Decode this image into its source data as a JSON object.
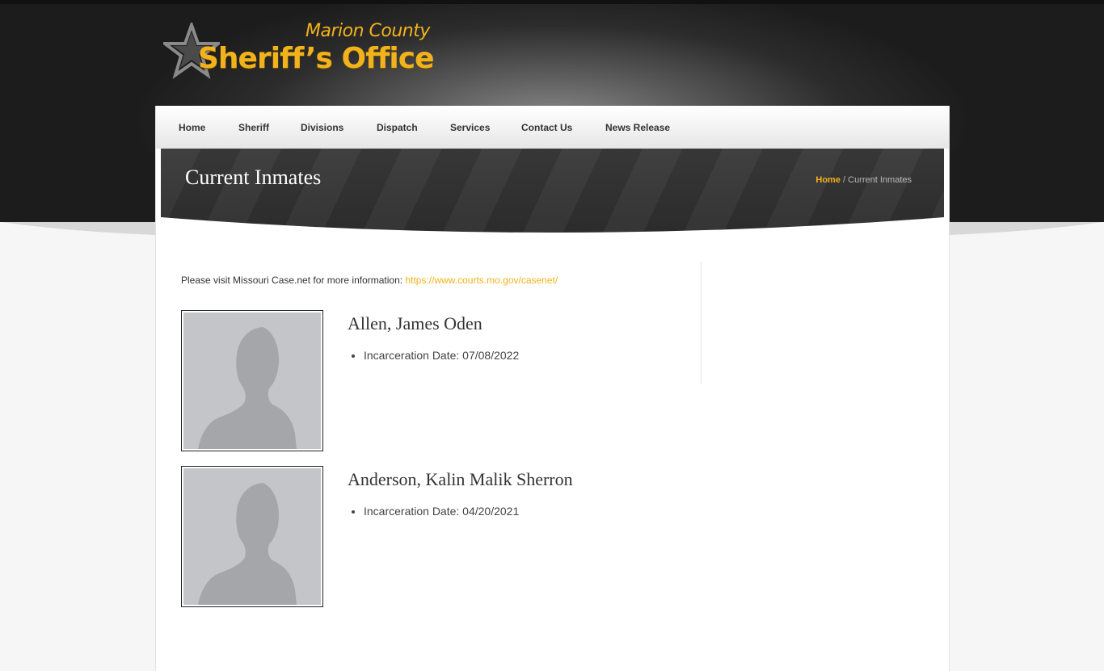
{
  "header": {
    "logo_county": "Marion County",
    "logo_office": "Sheriff’s Office",
    "brand_color": "#f2b21c"
  },
  "nav": {
    "items": [
      {
        "label": "Home"
      },
      {
        "label": "Sheriff"
      },
      {
        "label": "Divisions"
      },
      {
        "label": "Dispatch"
      },
      {
        "label": "Services"
      },
      {
        "label": "Contact Us"
      },
      {
        "label": "News Release"
      }
    ]
  },
  "page": {
    "title": "Current Inmates",
    "breadcrumb_home": "Home",
    "breadcrumb_separator": " / ",
    "breadcrumb_current": "Current Inmates"
  },
  "content": {
    "info_text": "Please visit Missouri Case.net for more information: ",
    "info_link": "https://www.courts.mo.gov/casenet/"
  },
  "inmates": [
    {
      "name": "Allen, James Oden",
      "detail": "Incarceration Date: 07/08/2022",
      "photo_icon": "person-silhouette-icon"
    },
    {
      "name": "Anderson, Kalin Malik Sherron",
      "detail": "Incarceration Date: 04/20/2021",
      "photo_icon": "person-silhouette-icon"
    }
  ]
}
